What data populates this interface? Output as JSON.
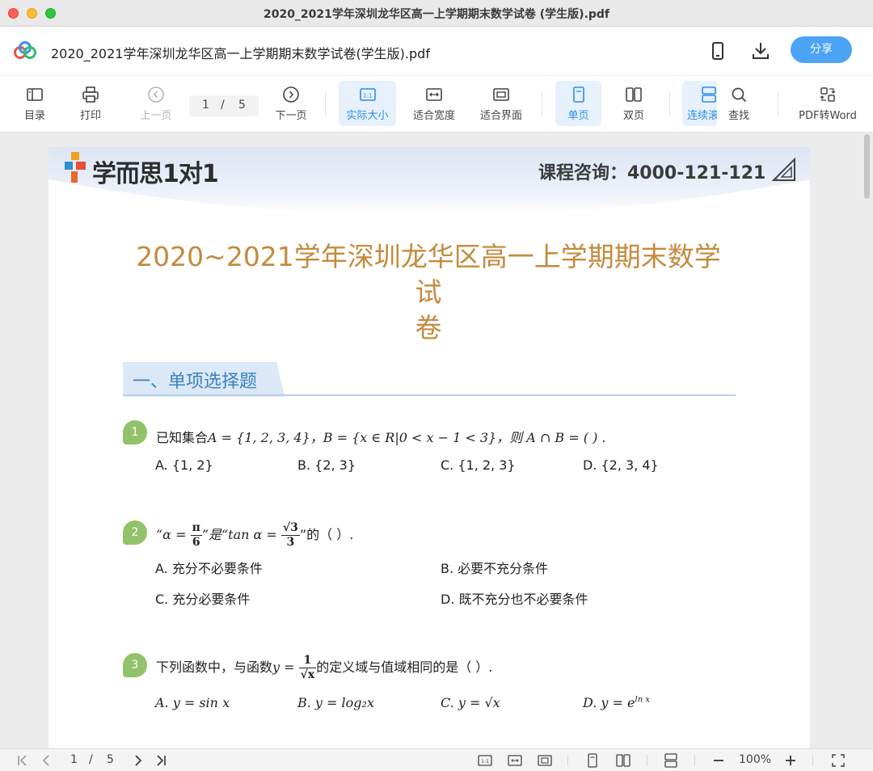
{
  "window": {
    "title": "2020_2021学年深圳龙华区高一上学期期末数学试卷 (学生版).pdf"
  },
  "header": {
    "doc_name": "2020_2021学年深圳龙华区高一上学期期末数学试卷(学生版).pdf",
    "share_label": "分享"
  },
  "toolbar": {
    "toc": "目录",
    "print": "打印",
    "prev_page": "上一页",
    "current_page": "1",
    "slash": "/",
    "total_pages": "5",
    "next_page": "下一页",
    "actual_size": "实际大小",
    "fit_width": "适合宽度",
    "fit_window": "适合界面",
    "single_page": "单页",
    "two_page": "双页",
    "continuous": "连续滚",
    "search": "查找",
    "pdf_to_word": "PDF转Word"
  },
  "document": {
    "brand": "学而思1对1",
    "consult": "课程咨询：4000-121-121",
    "title_line1": "2020~2021学年深圳龙华区高一上学期期末数学试",
    "title_line2": "卷",
    "section_heading": "一、单项选择题",
    "questions": [
      {
        "number": "1",
        "prefix": "已知集合",
        "stem_math": "A = {1, 2, 3, 4}，B = {x ∈ R|0 < x − 1 < 3}，则 A ∩ B = (    ) .",
        "options": [
          "A.  {1, 2}",
          "B.  {2, 3}",
          "C.  {1, 2, 3}",
          "D.  {2, 3, 4}"
        ]
      },
      {
        "number": "2",
        "stem_a": "“α = ",
        "frac1_num": "π",
        "frac1_den": "6",
        "stem_b": "”是“tan α = ",
        "frac2_num": "√3",
        "frac2_den": "3",
        "stem_c": "”的（    ）.",
        "options": [
          "A.  充分不必要条件",
          "B.  必要不充分条件",
          "C.  充分必要条件",
          "D.  既不充分也不必要条件"
        ]
      },
      {
        "number": "3",
        "stem_a": "下列函数中，与函数",
        "stem_math": "y = ",
        "frac_num": "1",
        "frac_den": "√x",
        "stem_b": "的定义域与值域相同的是（    ）.",
        "options": [
          "A.  y = sin x",
          "B.  y = log₂x",
          "C.  y = √x",
          "D.  y = e"
        ],
        "option_d_sup": "ln x"
      }
    ]
  },
  "statusbar": {
    "current_page": "1",
    "slash": "/",
    "total_pages": "5",
    "zoom": "100%"
  },
  "colors": {
    "accent": "#4aa3f5",
    "title_orange": "#c58a3c",
    "section_blue": "#3b82c4",
    "qnum_green": "#92c269"
  }
}
